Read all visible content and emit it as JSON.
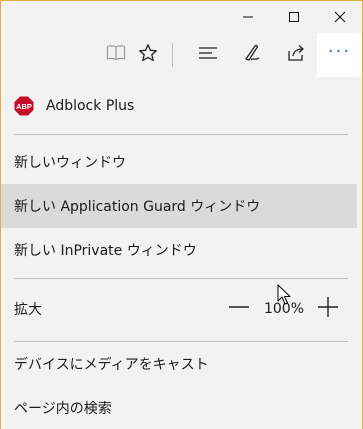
{
  "window": {
    "controls": {
      "minimize": "minimize-icon",
      "maximize": "maximize-icon",
      "close": "close-icon"
    }
  },
  "toolbar": {
    "icons": [
      "reading-view-icon",
      "favorites-star-icon",
      "hub-icon",
      "web-note-icon",
      "share-icon",
      "more-icon"
    ],
    "more_label": "···",
    "accent_color": "#2a73d0"
  },
  "menu": {
    "extension": {
      "label": "Adblock Plus",
      "icon_text": "ABP"
    },
    "items": {
      "new_window": "新しいウィンドウ",
      "new_guard_window": "新しい Application Guard ウィンドウ",
      "new_private_window": "新しい InPrivate ウィンドウ",
      "cast_media": "デバイスにメディアをキャスト",
      "find_on_page": "ページ内の検索"
    },
    "zoom": {
      "label": "拡大",
      "value": "100%"
    }
  }
}
